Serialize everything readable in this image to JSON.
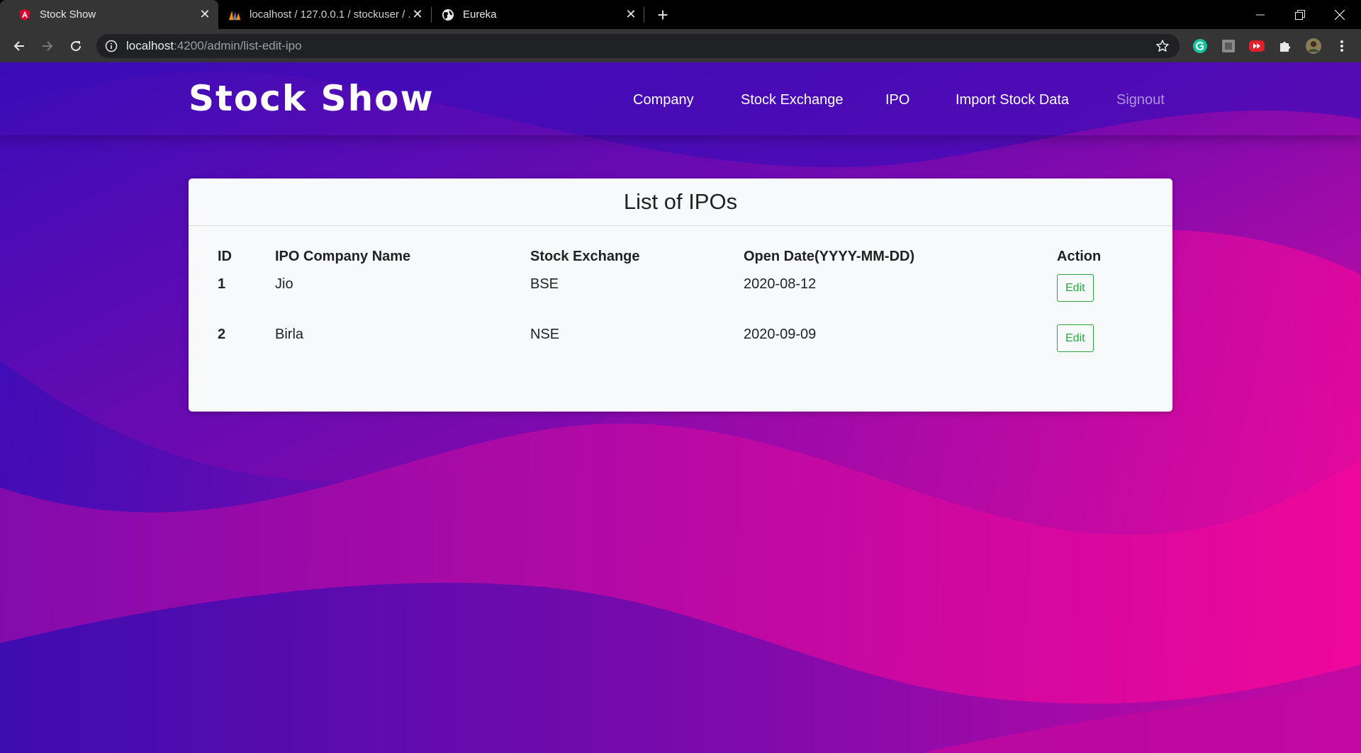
{
  "browser": {
    "tabs": [
      {
        "title": "Stock Show",
        "active": true,
        "icon": "angular-icon"
      },
      {
        "title": "localhost / 127.0.0.1 / stockuser / ...",
        "active": false,
        "icon": "phpmyadmin-icon"
      },
      {
        "title": "Eureka",
        "active": false,
        "icon": "globe-icon"
      }
    ],
    "url_host": "localhost",
    "url_path": ":4200/admin/list-edit-ipo"
  },
  "header": {
    "brand": "Stock Show",
    "nav": [
      {
        "label": "Company",
        "muted": false
      },
      {
        "label": "Stock Exchange",
        "muted": false
      },
      {
        "label": "IPO",
        "muted": false
      },
      {
        "label": "Import Stock Data",
        "muted": false
      },
      {
        "label": "Signout",
        "muted": true
      }
    ]
  },
  "card": {
    "title": "List of IPOs",
    "columns": [
      "ID",
      "IPO Company Name",
      "Stock Exchange",
      "Open Date(YYYY-MM-DD)",
      "Action"
    ],
    "rows": [
      {
        "id": "1",
        "company": "Jio",
        "exchange": "BSE",
        "open_date": "2020-08-12",
        "action": "Edit"
      },
      {
        "id": "2",
        "company": "Birla",
        "exchange": "NSE",
        "open_date": "2020-09-09",
        "action": "Edit"
      }
    ]
  },
  "colors": {
    "gradient_start": "#3a0cb8",
    "gradient_end": "#ff0d9a",
    "edit_button": "#28a745"
  }
}
